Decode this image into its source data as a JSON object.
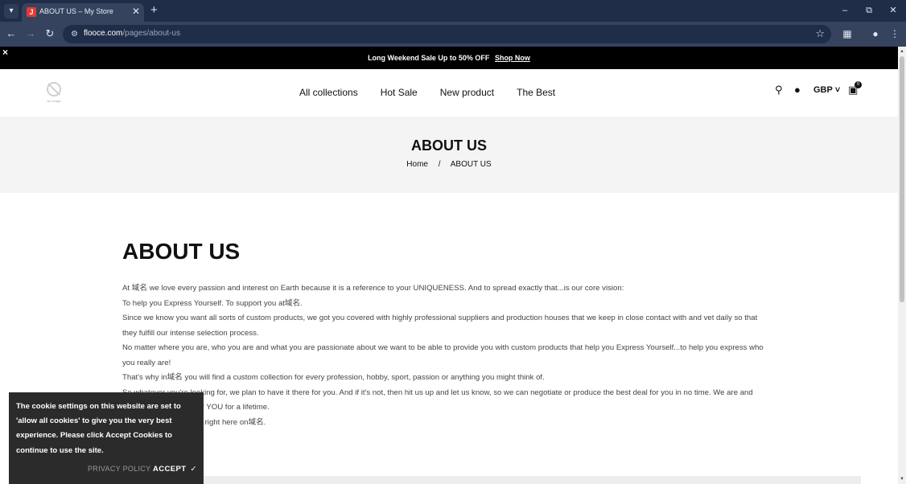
{
  "browser": {
    "tab": {
      "title": "ABOUT US – My Store",
      "favicon": "J"
    },
    "url": {
      "host": "flooce.com",
      "path": "/pages/about-us"
    }
  },
  "announcement": {
    "text": "Long Weekend Sale Up to 50% OFF",
    "link": "Shop Now"
  },
  "header": {
    "logo_caption": "No image",
    "nav": [
      "All collections",
      "Hot Sale",
      "New product",
      "The Best"
    ],
    "currency": "GBP",
    "cart_count": "0"
  },
  "hero": {
    "title": "ABOUT US",
    "breadcrumb": {
      "home": "Home",
      "separator": "/",
      "current": "ABOUT US"
    }
  },
  "content": {
    "title": "ABOUT US",
    "paragraphs": [
      "At 域名 we love every passion and interest on Earth because it is a reference to your UNIQUENESS. And to spread exactly that...is our core vision:",
      "To help you Express Yourself. To support you at域名.",
      "Since we know you want all sorts of custom products, we got you covered with highly professional suppliers and production houses that we keep in close contact with and vet daily so that",
      "they fulfill our intense selection process.",
      "No matter where you are, who you are and what you are passionate about we want to be able to provide you with custom products that help you Express Yourself...to help you express who",
      "you really are!",
      "That's why in域名 you will find a custom collection for every profession, hobby, sport, passion or anything you might think of.",
      "So whatever you're looking for, we plan to have it there for you. And if it's not, then hit us up and let us know, so we can negotiate or produce the best deal for you in no time. We are and",
      "would like to be here for YOU for a lifetime.",
      "Whatever you need, it's right here on域名."
    ]
  },
  "cookie": {
    "message": "The cookie settings on this website are set to 'allow all cookies' to give you the very best experience. Please click Accept Cookies to continue to use the site.",
    "policy_label": "PRIVACY POLICY",
    "accept_label": "ACCEPT"
  },
  "colors": {
    "chrome_dark": "#1f2d48",
    "chrome_toolbar": "#35435e",
    "announcement_bg": "#000000",
    "hero_bg": "#f4f4f4",
    "cookie_bg": "#2b2b2b"
  }
}
